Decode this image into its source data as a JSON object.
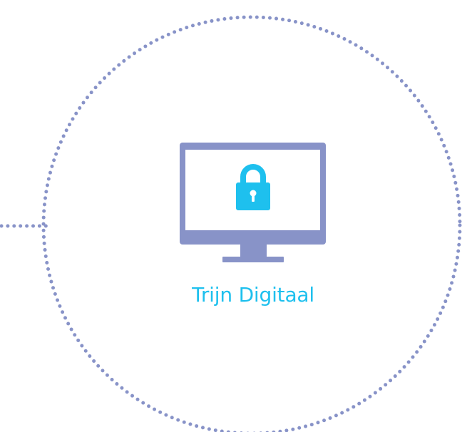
{
  "node": {
    "label": "Trijn Digitaal",
    "icon": "locked-computer-icon"
  },
  "colors": {
    "dots": "#8893c8",
    "monitor": "#8893c8",
    "screen": "#ffffff",
    "lock": "#1ec0ee",
    "label": "#1ec0ee",
    "background": "#ffffff"
  }
}
